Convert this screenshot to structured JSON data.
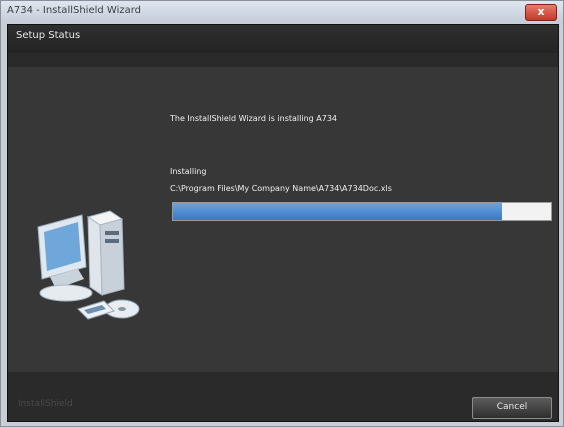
{
  "window": {
    "title": "A734 - InstallShield Wizard",
    "close_glyph": "x"
  },
  "header": {
    "title": "Setup Status"
  },
  "main": {
    "status_text": "The InstallShield Wizard is installing A734",
    "step_label": "Installing",
    "file_path": "C:\\Program Files\\My Company Name\\A734\\A734Doc.xls",
    "progress_fraction": 0.87
  },
  "footer": {
    "brand": "InstallShield",
    "cancel_label": "Cancel"
  },
  "colors": {
    "progress_fill": "#3a78c4",
    "close_button": "#c4382a"
  },
  "icons": {
    "setup_art": "computer-with-disc-icon"
  }
}
